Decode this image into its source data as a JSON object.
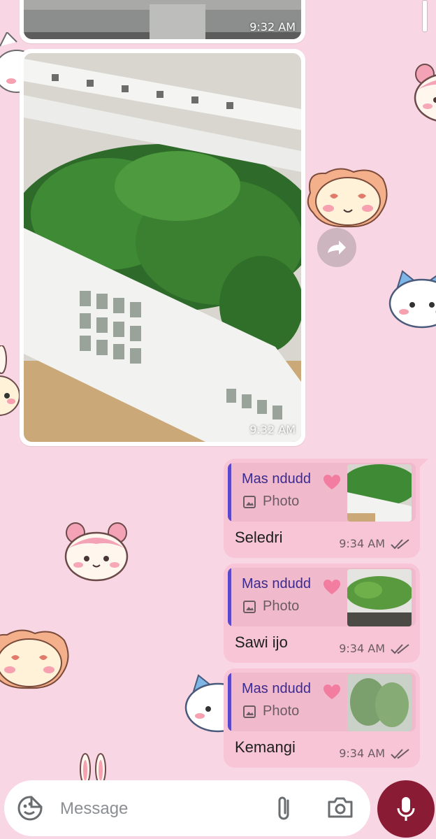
{
  "theme": {
    "wallpaper": "#f9d6e3",
    "outgoing_bubble": "#f7c5d6",
    "quote_bar": "#5b47c9",
    "mic_button": "#8a1b35"
  },
  "wallpaper_icons": [
    "hamster-character-icon",
    "cat-character-icon",
    "lion-character-icon",
    "bunny-character-icon"
  ],
  "messages": {
    "incoming": [
      {
        "time": "9:32 AM",
        "media": "photo"
      },
      {
        "time": "9:32 AM",
        "media": "photo"
      }
    ],
    "outgoing": [
      {
        "reply_author": "Mas ndudd",
        "reply_kind": "Photo",
        "text": "Seledri",
        "time": "9:34 AM",
        "status": "read-double-check-icon"
      },
      {
        "reply_author": "Mas ndudd",
        "reply_kind": "Photo",
        "text": "Sawi ijo",
        "time": "9:34 AM",
        "status": "read-double-check-icon"
      },
      {
        "reply_author": "Mas ndudd",
        "reply_kind": "Photo",
        "text": "Kemangi",
        "time": "9:34 AM",
        "status": "read-double-check-icon"
      }
    ]
  },
  "composer": {
    "placeholder": "Message",
    "value": ""
  }
}
